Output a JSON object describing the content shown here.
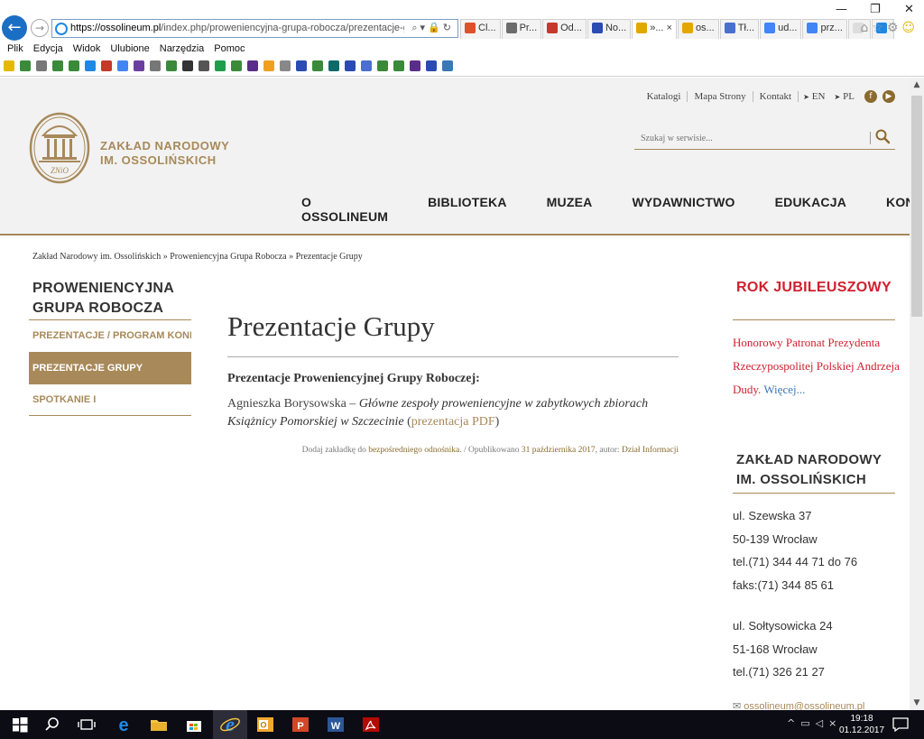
{
  "browser": {
    "url_domain": "https://ossolineum.pl",
    "url_path": "/index.php/proweniencyjna-grupa-robocza/prezentacje-grupy/",
    "tabs": [
      {
        "label": "Cl...",
        "color": "#e0502a"
      },
      {
        "label": "Pr...",
        "color": "#6b6b6b"
      },
      {
        "label": "Od...",
        "color": "#c53929"
      },
      {
        "label": "No...",
        "color": "#2a4bb3"
      },
      {
        "label": "»...",
        "color": "#e0a800",
        "active": true,
        "close": "×"
      },
      {
        "label": "os...",
        "color": "#e0a800"
      },
      {
        "label": "Tł...",
        "color": "#4a6fd1"
      },
      {
        "label": "ud...",
        "color": "#4285f4"
      },
      {
        "label": "prz...",
        "color": "#4285f4"
      }
    ],
    "menu": [
      "Plik",
      "Edycja",
      "Widok",
      "Ulubione",
      "Narzędzia",
      "Pomoc"
    ],
    "window_controls": {
      "minimize": "—",
      "restore": "❐",
      "close": "✕"
    }
  },
  "header": {
    "toplinks": [
      "Katalogi",
      "Mapa Strony",
      "Kontakt"
    ],
    "languages": [
      "EN",
      "PL"
    ],
    "logo_line1": "ZAKŁAD NARODOWY",
    "logo_line2": "IM. OSSOLIŃSKICH",
    "logo_initials": "ZNiO",
    "search_placeholder": "Szukaj w serwisie...",
    "nav": [
      "O OSSOLINEUM",
      "BIBLIOTEKA",
      "MUZEA",
      "WYDAWNICTWO",
      "EDUKACJA",
      "KONTAKT"
    ],
    "accent_color": "#a8895a"
  },
  "breadcrumb": "Zakład Narodowy im. Ossolińskich » Proweniencyjna Grupa Robocza » Prezentacje Grupy",
  "sidebar": {
    "title_line1": "PROWENIENCYJNA",
    "title_line2": "GRUPA ROBOCZA",
    "items": [
      {
        "label": "PREZENTACJE / PROGRAM KONF..."
      },
      {
        "label": "PREZENTACJE GRUPY",
        "active": true
      },
      {
        "label": "SPOTKANIE I"
      }
    ]
  },
  "article": {
    "title": "Prezentacje Grupy",
    "subtitle": "Prezentacje Proweniencyjnej Grupy Roboczej:",
    "author": "Agnieszka Borysowska – ",
    "work_title": "Główne zespoły proweniencyjne w zabytkowych zbiorach Książnicy Pomorskiej w Szczecinie",
    "link_open": " (",
    "link_text": "prezentacja PDF",
    "link_close": ")",
    "meta_prefix": "Dodaj zakładkę do ",
    "meta_link": "bezpośredniego odnośnika",
    "meta_mid": ". / Opublikowano ",
    "meta_date": "31 października 2017",
    "meta_author_prefix": ", autor: ",
    "meta_author": "Dział Informacji"
  },
  "right": {
    "jubilee_title": "ROK JUBILEUSZOWY",
    "jubilee_text": "Honorowy Patronat Prezydenta Rzeczypospolitej Polskiej Andrzeja Dudy. ",
    "jubilee_more": "Więcej...",
    "org_line1": "ZAKŁAD NARODOWY",
    "org_line2": "IM. OSSOLIŃSKICH",
    "address1": [
      "ul. Szewska 37",
      "50-139 Wrocław",
      "tel.(71) 344 44 71 do 76",
      "faks:(71) 344 85 61"
    ],
    "address2": [
      "ul. Sołtysowicka 24",
      "51-168 Wrocław",
      "tel.(71) 326 21 27"
    ],
    "email": "ossolineum@ossolineum.pl"
  },
  "taskbar": {
    "time": "19:18",
    "date": "01.12.2017"
  }
}
